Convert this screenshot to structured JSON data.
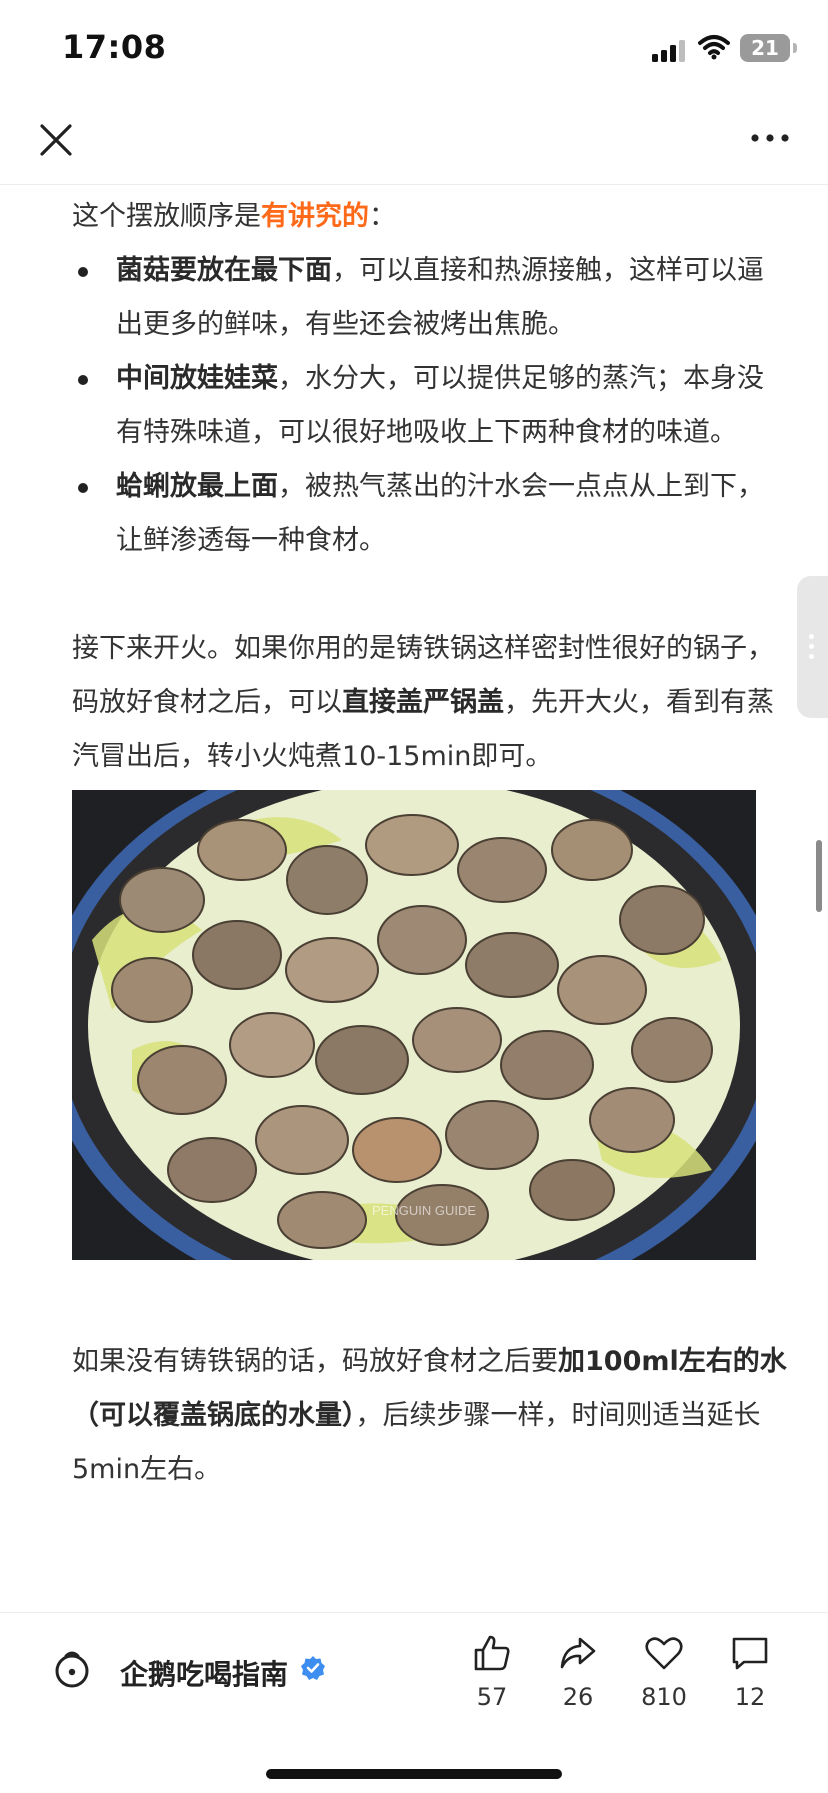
{
  "status_bar": {
    "time": "17:08",
    "battery": "21"
  },
  "nav": {
    "close_icon": "close-icon",
    "more_icon": "more-icon"
  },
  "article": {
    "intro_prefix": "这个摆放顺序是",
    "intro_accent": "有讲究的",
    "intro_suffix": "：",
    "bullets": [
      {
        "bold": "菌菇要放在最下面",
        "text": "，可以直接和热源接触，这样可以逼出更多的鲜味，有些还会被烤出焦脆。"
      },
      {
        "bold": "中间放娃娃菜",
        "text": "，水分大，可以提供足够的蒸汽；本身没有特殊味道，可以很好地吸收上下两种食材的味道。"
      },
      {
        "bold": "蛤蜊放最上面",
        "text": "，被热气蒸出的汁水会一点点从上到下，让鲜渗透每一种食材。"
      }
    ],
    "para2_a": "接下来开火。如果你用的是铸铁锅这样密封性很好的锅子，码放好食材之后，可以",
    "para2_bold": "直接盖严锅盖",
    "para2_b": "，先开大火，看到有蒸汽冒出后，转小火炖煮10-15min即可。",
    "photo_watermark": "PENGUIN GUIDE",
    "para3_a": "如果没有铸铁锅的话，码放好食材之后要",
    "para3_bold": "加100ml左右的水（可以覆盖锅底的水量）",
    "para3_b": "，后续步骤一样，时间则适当延长5min左右。"
  },
  "bottom_bar": {
    "author": "企鹅吃喝指南",
    "like_count": "57",
    "share_count": "26",
    "favorite_count": "810",
    "comment_count": "12"
  },
  "colors": {
    "accent": "#ff6a1a",
    "verified": "#3d8ef0"
  }
}
